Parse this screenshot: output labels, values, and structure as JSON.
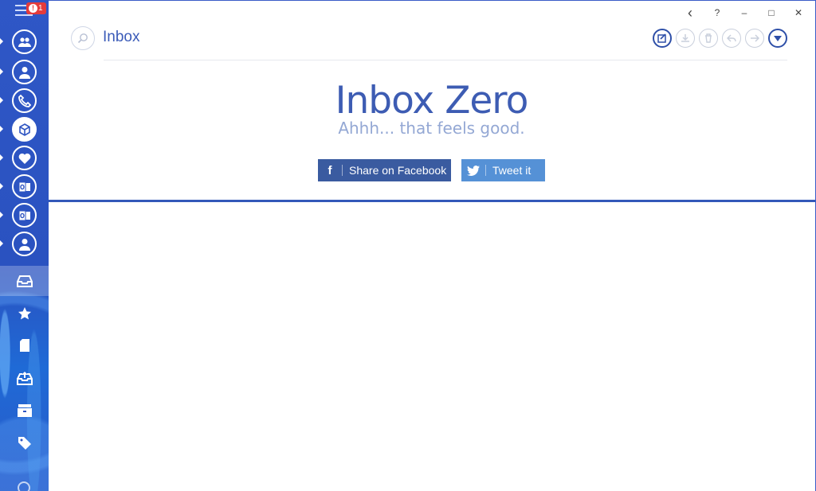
{
  "sidebar": {
    "notification_count": "1",
    "accounts": [
      {
        "name": "accounts-group",
        "icon": "people-icon"
      },
      {
        "name": "account-person",
        "icon": "person-icon"
      },
      {
        "name": "account-phone",
        "icon": "phone-icon"
      },
      {
        "name": "account-box",
        "icon": "cube-icon",
        "active": true
      },
      {
        "name": "account-heart",
        "icon": "heart-icon"
      },
      {
        "name": "account-outlook-1",
        "icon": "outlook-icon"
      },
      {
        "name": "account-outlook-2",
        "icon": "outlook-icon"
      },
      {
        "name": "account-person-2",
        "icon": "person-icon"
      }
    ],
    "folders": [
      {
        "name": "inbox",
        "icon": "inbox-tray-icon",
        "active": true
      },
      {
        "name": "starred",
        "icon": "star-icon"
      },
      {
        "name": "drafts",
        "icon": "document-icon"
      },
      {
        "name": "sent",
        "icon": "outbox-icon"
      },
      {
        "name": "archive",
        "icon": "archive-icon"
      },
      {
        "name": "tags",
        "icon": "tag-icon"
      }
    ]
  },
  "window": {
    "back": "‹",
    "help": "?",
    "minimize": "–",
    "maximize": "□",
    "close": "✕"
  },
  "header": {
    "title": "Inbox",
    "toolbar": [
      "compose-icon",
      "download-icon",
      "trash-icon",
      "reply-icon",
      "forward-icon",
      "more-dropdown-icon"
    ]
  },
  "empty_state": {
    "title": "Inbox Zero",
    "subtitle": "Ahhh... that feels good.",
    "facebook_label": "Share on Facebook",
    "twitter_label": "Tweet it"
  },
  "colors": {
    "accent": "#3358b9",
    "sidebar": "#2f55c2",
    "facebook": "#3a5ba0",
    "twitter": "#5591d6"
  }
}
